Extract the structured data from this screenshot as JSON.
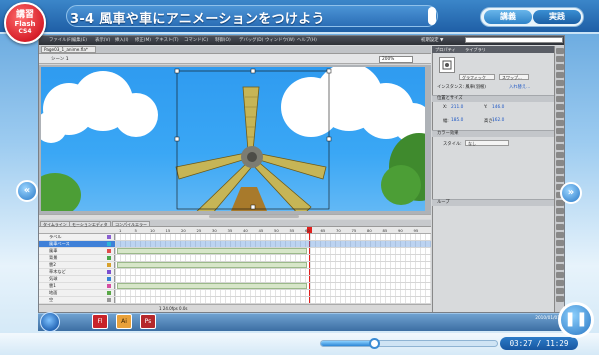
{
  "lesson": {
    "badge_line1": "講習",
    "badge_line2": "Flash",
    "badge_line3": "CS4",
    "title": "3-4 風車や車にアニメーションをつけよう"
  },
  "mode_toggle": {
    "lecture": "講義",
    "practice": "実践"
  },
  "app": {
    "menus": [
      "ファイル(F)",
      "編集(E)",
      "表示(V)",
      "挿入(I)",
      "修正(M)",
      "テキスト(T)",
      "コマンド(C)",
      "制御(O)",
      "デバッグ(D)",
      "ウィンドウ(W)",
      "ヘルプ(H)"
    ],
    "workspace": "初期設定 ▼",
    "document_tab": "Page03_1_anime.fla*",
    "scene": "シーン 1",
    "zoom": "200%",
    "timeline_tabs": [
      "タイムライン",
      "モーションエディタ",
      "コンパイルエラー"
    ],
    "frame_numbers": [
      "1",
      "5",
      "10",
      "15",
      "20",
      "25",
      "30",
      "35",
      "40",
      "45",
      "50",
      "55",
      "60",
      "65",
      "70",
      "75",
      "80",
      "85",
      "90",
      "95"
    ],
    "layers": [
      {
        "name": "ラベル",
        "selected": false
      },
      {
        "name": "風車ベース",
        "selected": true
      },
      {
        "name": "風車",
        "selected": false
      },
      {
        "name": "背景",
        "selected": false
      },
      {
        "name": "雲2",
        "selected": false
      },
      {
        "name": "草木など",
        "selected": false
      },
      {
        "name": "気球",
        "selected": false
      },
      {
        "name": "雲1",
        "selected": false
      },
      {
        "name": "地面",
        "selected": false
      },
      {
        "name": "空",
        "selected": false
      }
    ],
    "timeline_footer": "1  24.0fps  0.0s"
  },
  "properties": {
    "tabs": [
      "プロパティ",
      "ライブラリ"
    ],
    "symbol_type": "グラフィック",
    "swap_button": "スワップ...",
    "instance_label": "インスタンス: 風車(羽根)",
    "swap_link": "入れ替え...",
    "section_position": "位置とサイズ",
    "x_label": "X:",
    "x_value": "211.0",
    "y_label": "Y:",
    "y_value": "146.0",
    "w_label": "幅:",
    "w_value": "185.0",
    "h_label": "高さ:",
    "h_value": "162.0",
    "section_color": "カラー効果",
    "style_label": "スタイル:",
    "style_value": "なし",
    "section_loop": "ループ"
  },
  "taskbar": {
    "apps": [
      "Fl",
      "Ai",
      "Ps"
    ],
    "date": "2010/01/01"
  },
  "playback": {
    "elapsed": "03:27",
    "total": "11:29",
    "progress": 0.3
  },
  "icons": [
    "prev-icon",
    "next-icon",
    "pause-icon",
    "windows-start-icon"
  ],
  "colors": {
    "accent": "#2f83c8",
    "badge": "#d71f2a",
    "playhead": "#e0201e",
    "sky": "#3aa7f5"
  }
}
